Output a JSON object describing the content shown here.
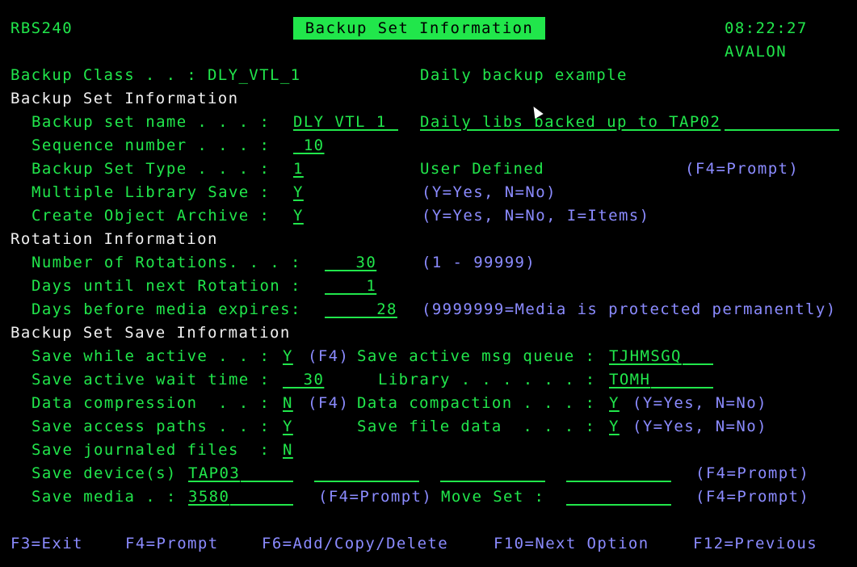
{
  "header": {
    "program": "RBS240",
    "title": "Backup Set Information",
    "time": "08:22:27",
    "system": "AVALON"
  },
  "backup_class": {
    "label": "Backup Class . . : DLY_VTL_1",
    "description": "Daily backup example"
  },
  "sections": {
    "backup_set": "Backup Set Information",
    "rotation": "Rotation Information",
    "save": "Backup Set Save Information"
  },
  "fields": {
    "set_name": {
      "label": "Backup set name . . . :",
      "value": "DLY_VTL_1",
      "description": "Daily libs backed up to TAP02"
    },
    "sequence": {
      "label": "Sequence number . . . :",
      "value": " 10"
    },
    "set_type": {
      "label": "Backup Set Type . . . :",
      "value": "1",
      "description": "User Defined",
      "hint": "(F4=Prompt)"
    },
    "multi_lib": {
      "label": "Multiple Library Save :",
      "value": "Y",
      "hint": "(Y=Yes, N=No)"
    },
    "archive": {
      "label": "Create Object Archive :",
      "value": "Y",
      "hint": "(Y=Yes, N=No, I=Items)"
    },
    "rotations": {
      "label": "Number of Rotations. . . :",
      "value": "   30",
      "hint": "(1 - 99999)"
    },
    "days_next": {
      "label": "Days until next Rotation :",
      "value": "    1"
    },
    "days_expire": {
      "label": "Days before media expires:",
      "value": "     28",
      "hint": "(9999999=Media is protected permanently)"
    },
    "save_active": {
      "label": "Save while active . . :",
      "value": "Y",
      "f4": "(F4)"
    },
    "msg_queue": {
      "label": "Save active msg queue :",
      "value": "TJHMSGQ"
    },
    "wait_time": {
      "label": "Save active wait time :",
      "value": "  30"
    },
    "library": {
      "label": "Library . . . . . . :",
      "value": "TOMH"
    },
    "compression": {
      "label": "Data compression  . . :",
      "value": "N",
      "f4": "(F4)"
    },
    "compaction": {
      "label": "Data compaction . . . :",
      "value": "Y",
      "hint": "(Y=Yes, N=No)"
    },
    "access_paths": {
      "label": "Save access paths . . :",
      "value": "Y"
    },
    "file_data": {
      "label": "Save file data  . . . :",
      "value": "Y",
      "hint": "(Y=Yes, N=No)"
    },
    "journaled": {
      "label": "Save journaled files  :",
      "value": "N"
    },
    "devices": {
      "label": "Save device(s)",
      "value": "TAP03",
      "hint": "(F4=Prompt)"
    },
    "media": {
      "label": "Save media . :",
      "value": "3580",
      "hint": "(F4=Prompt)"
    },
    "move_set": {
      "label": "Move Set :",
      "hint": "(F4=Prompt)"
    }
  },
  "function_keys": [
    "F3=Exit",
    "F4=Prompt",
    "F6=Add/Copy/Delete",
    "F10=Next Option",
    "F12=Previous"
  ]
}
